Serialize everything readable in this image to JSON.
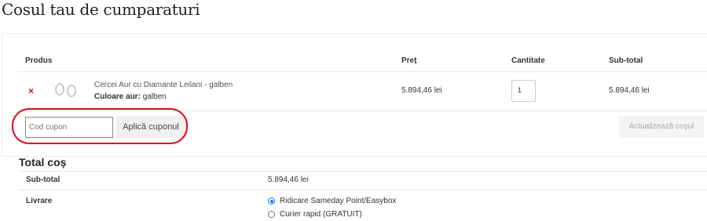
{
  "page": {
    "title": "Cosul tau de cumparaturi"
  },
  "cart": {
    "columns": {
      "product": "Produs",
      "price": "Preț",
      "quantity": "Cantitate",
      "subtotal": "Sub-total"
    },
    "remove_glyph": "×",
    "items": [
      {
        "name": "Cercei Aur cu Diamante Leilani - galben",
        "attr_label": "Culoare aur:",
        "attr_value": "galben",
        "price": "5.894,46 lei",
        "quantity": "1",
        "subtotal": "5.894,46 lei"
      }
    ],
    "coupon": {
      "placeholder": "Cod cupon",
      "apply_label": "Aplică cuponul"
    },
    "update_label": "Actualizează coșul"
  },
  "totals": {
    "title": "Total coș",
    "subtotal_label": "Sub-total",
    "subtotal_value": "5.894,46 lei",
    "shipping_label": "Livrare",
    "shipping_options": [
      {
        "label": "Ridicare Sameday Point/Easybox",
        "selected": true
      },
      {
        "label": "Curier rapid (GRATUIT)",
        "selected": false
      }
    ]
  },
  "colors": {
    "highlight": "#e3001b",
    "remove": "#d0021b",
    "radio_accent": "#1a73e8"
  }
}
